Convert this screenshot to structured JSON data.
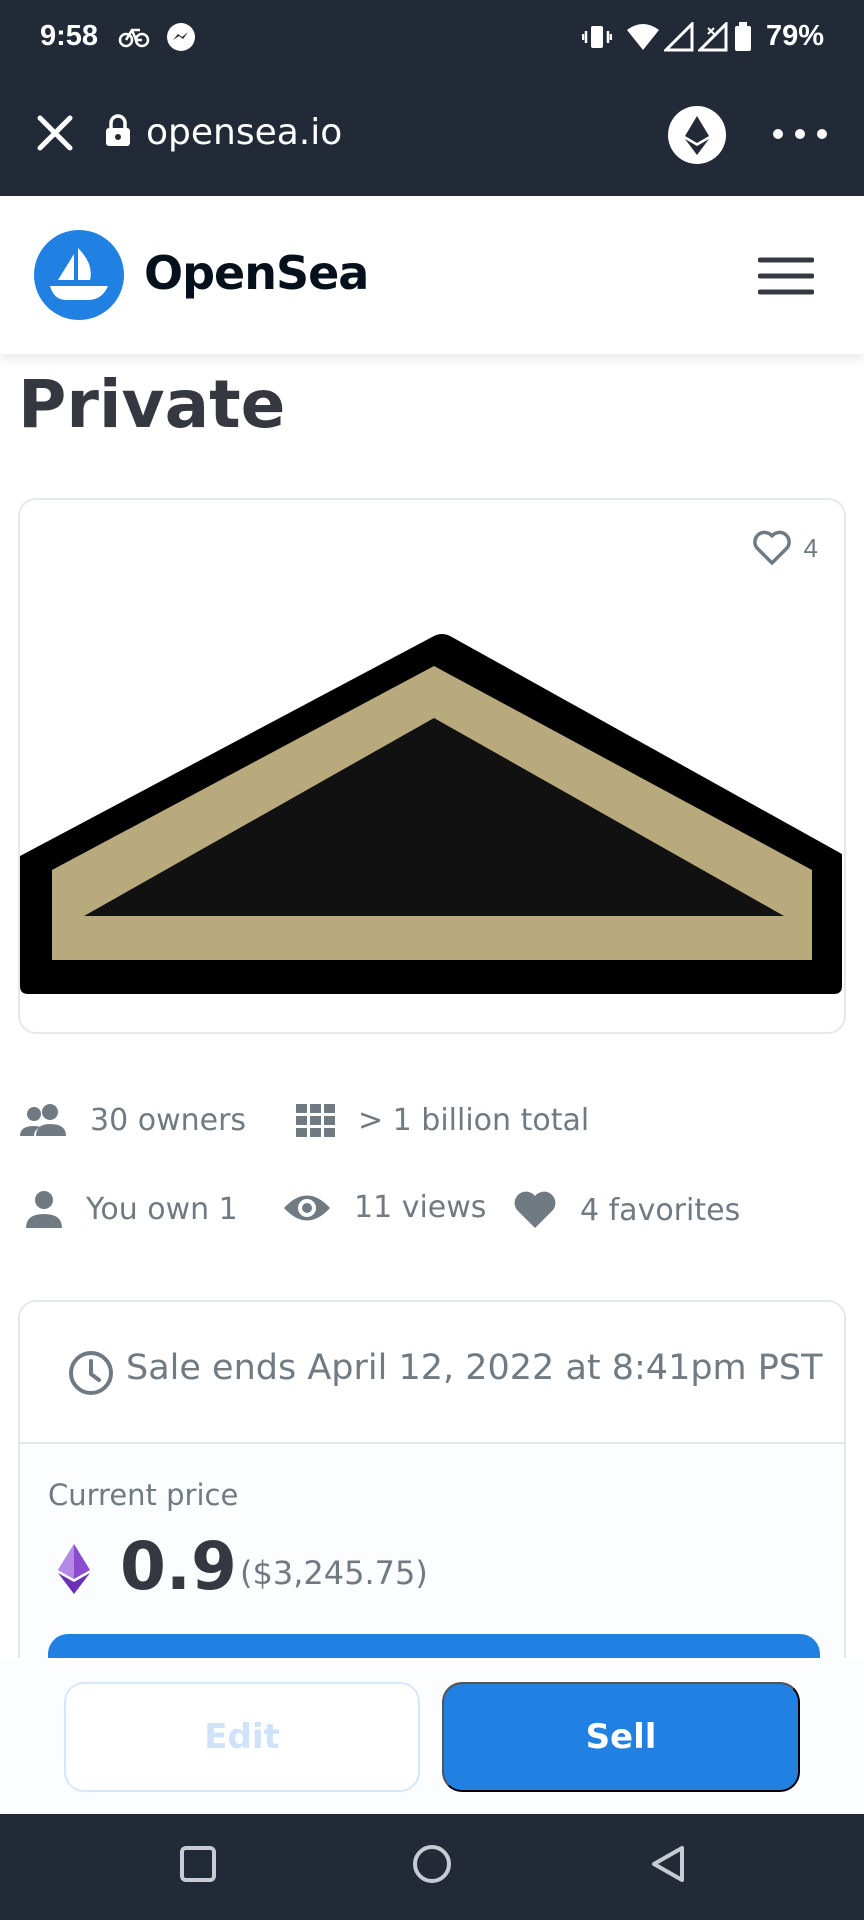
{
  "status_bar": {
    "time": "9:58",
    "battery": "79%"
  },
  "browser": {
    "url": "opensea.io"
  },
  "header": {
    "logo_text": "OpenSea"
  },
  "asset": {
    "title": "Private",
    "favorites_count": "4",
    "art_colors": {
      "outline": "#000000",
      "band": "#b8aa7c",
      "fill": "#111111"
    }
  },
  "stats": {
    "owners": "30 owners",
    "total": "> 1 billion total",
    "you_own": "You own 1",
    "views": "11 views",
    "favorites": "4 favorites"
  },
  "sale": {
    "ends_text": "Sale ends April 12, 2022 at 8:41pm PST",
    "price_label": "Current price",
    "price_eth": "0.9",
    "price_usd": "($3,245.75)"
  },
  "actions": {
    "edit_label": "Edit",
    "sell_label": "Sell"
  },
  "colors": {
    "accent": "#2081e2",
    "dark_bar": "#232a37",
    "text_primary": "#353840",
    "text_secondary": "#707a83"
  }
}
